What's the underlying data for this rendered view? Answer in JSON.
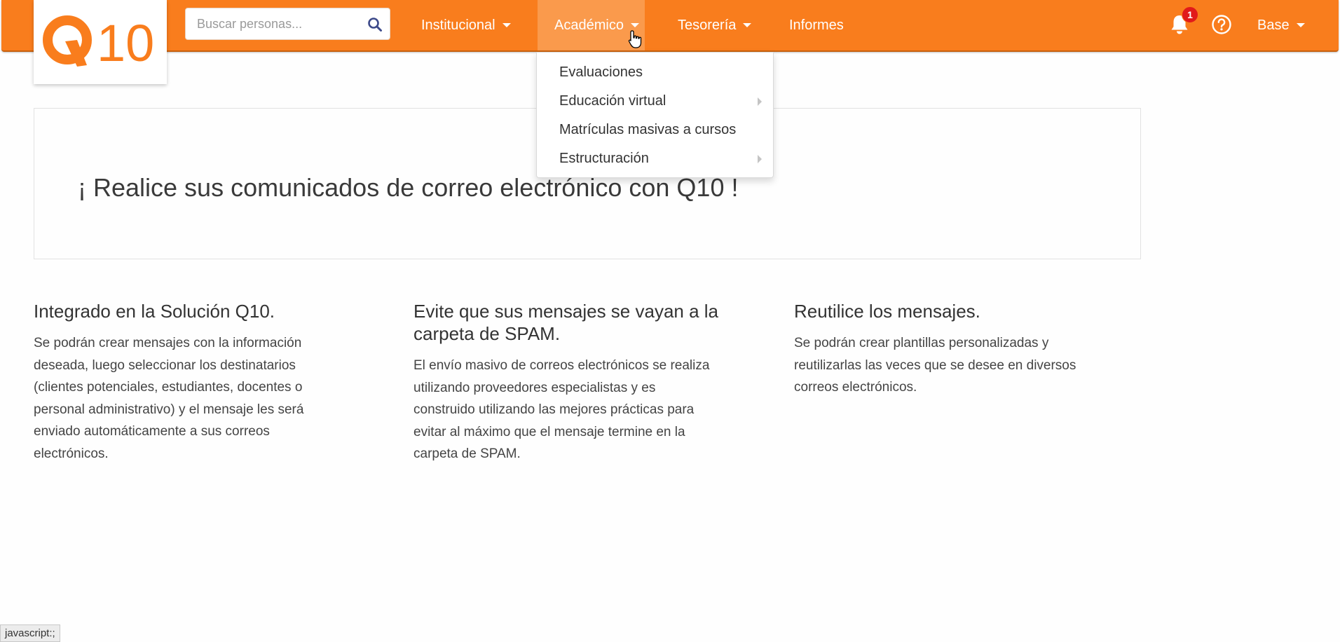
{
  "brand": {
    "logo_text": "Q10",
    "accent_color": "#f97d1d"
  },
  "search": {
    "placeholder": "Buscar personas...",
    "icon": "search-icon"
  },
  "nav": {
    "items": [
      {
        "label": "Institucional",
        "has_caret": true
      },
      {
        "label": "Académico",
        "has_caret": true,
        "active": true
      },
      {
        "label": "Tesorería",
        "has_caret": true
      },
      {
        "label": "Informes",
        "has_caret": false
      }
    ],
    "notifications": {
      "icon": "bell-icon",
      "count": "1"
    },
    "help_icon": "help-icon",
    "user_menu": {
      "label": "Base"
    }
  },
  "dropdown": {
    "items": [
      {
        "label": "Evaluaciones",
        "submenu": false
      },
      {
        "label": "Educación virtual",
        "submenu": true
      },
      {
        "label": "Matrículas masivas a cursos",
        "submenu": false
      },
      {
        "label": "Estructuración",
        "submenu": true
      }
    ]
  },
  "banner": {
    "title": "¡ Realice sus comunicados de correo electrónico con Q10 !"
  },
  "features": [
    {
      "title": "Integrado en la Solución Q10.",
      "lines": [
        "Se podrán crear mensajes con la información",
        "deseada, luego seleccionar los destinatarios",
        "(clientes potenciales, estudiantes, docentes o",
        "personal administrativo) y el mensaje les será",
        "enviado automáticamente a sus correos",
        "electrónicos."
      ]
    },
    {
      "title_lines": [
        "Evite que sus mensajes se vayan a la",
        "carpeta de SPAM."
      ],
      "lines": [
        "El envío masivo de correos electrónicos se realiza",
        "utilizando proveedores especialistas y es",
        "construido utilizando las mejores prácticas para",
        "evitar al máximo que el mensaje termine en la",
        "carpeta de SPAM."
      ]
    },
    {
      "title": "Reutilice los mensajes.",
      "lines": [
        "Se podrán crear plantillas personalizadas y",
        "reutilizarlas las veces que se desee en diversos",
        "correos electrónicos."
      ]
    }
  ],
  "statusbar": {
    "text": "javascript:;"
  }
}
